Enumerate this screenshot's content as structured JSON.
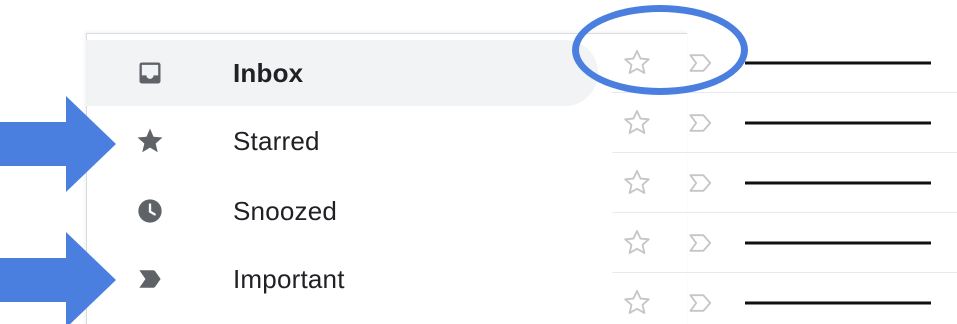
{
  "nav": {
    "items": [
      {
        "label": "Inbox",
        "icon": "inbox-icon",
        "active": true
      },
      {
        "label": "Starred",
        "icon": "star-icon",
        "active": false
      },
      {
        "label": "Snoozed",
        "icon": "clock-icon",
        "active": false
      },
      {
        "label": "Important",
        "icon": "important-label-icon",
        "active": false
      }
    ]
  },
  "mail_rows": {
    "count_visible": 5,
    "row_icons": [
      "star-outline-icon",
      "important-outline-icon"
    ]
  },
  "colors": {
    "accent_blue": "#4a7fe0",
    "active_row_bg": "#f1f3f4",
    "icon_gray": "#5f6368",
    "outline_icon_gray": "#c4c7c5"
  }
}
